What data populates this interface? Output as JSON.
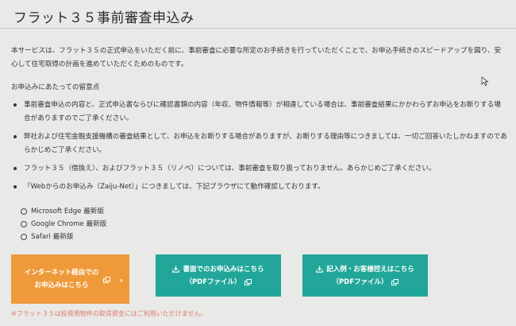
{
  "page": {
    "title": "フラット３５事前審査申込み",
    "intro": "本サービスは、フラット３５の正式申込をいただく前に、事前審査に必要な所定のお手続きを行っていただくことで、お申込手続きのスピードアップを図り、安心して住宅取得の計画を進めていただくためのものです。",
    "notes_title": "お申込みにあたっての留意点",
    "bullets": [
      "事前審査申込の内容と、正式申込書ならびに確認書類の内容（年収、物件情報等）が相違している場合は、事前審査結果にかかわらずお申込をお断りする場合がありますのでご了承ください。",
      "弊社および住宅金融支援機構の審査結果として、お申込をお断りする場合がありますが、お断りする理由等につきましては、一切ご回答いたしかねますのであらかじめご了承ください。",
      "フラット３５（借換え）、およびフラット３５（リノベ）については、事前審査を取り扱っておりません。あらかじめご了承ください。",
      "「Webからのお申込み（Zaiju-Net）」につきましては、下記ブラウザにて動作確認しております。"
    ],
    "browsers": [
      "Microsoft Edge 最新版",
      "Google Chrome 最新版",
      "Safari 最新版"
    ],
    "buttons": {
      "internet_line1": "インターネット経由での",
      "internet_line2": "お申込みはこちら",
      "paper_line1": "書面でのお申込みはこちら",
      "paper_line2": "（PDFファイル）",
      "example_line1": "記入例・お客様控えはこちら",
      "example_line2": "（PDFファイル）"
    },
    "footnote": "※フラット３５は投資用物件の取得資金にはご利用いただけません。"
  },
  "colors": {
    "orange": "#ee9a3a",
    "teal": "#22a69a",
    "footnote": "#e07b6b"
  }
}
